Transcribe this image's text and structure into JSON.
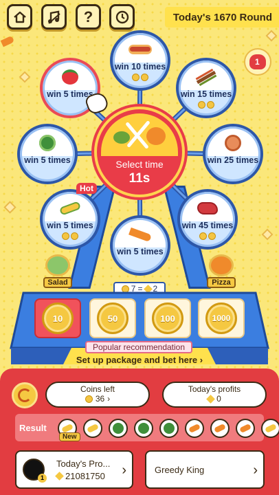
{
  "header": {
    "round_title": "Today's 1670 Round"
  },
  "wheel": {
    "pods": [
      {
        "label": "win 10 times",
        "food": "hotdog-icon",
        "coins": 2
      },
      {
        "label": "win 15 times",
        "food": "kebab-icon",
        "coins": 2
      },
      {
        "label": "win 25 times",
        "food": "ham-icon",
        "coins": 0
      },
      {
        "label": "win 45 times",
        "food": "steak-icon",
        "coins": 2
      },
      {
        "label": "win 5 times",
        "food": "carrot-icon",
        "coins": 0
      },
      {
        "label": "win 5 times",
        "food": "corn-icon",
        "coins": 2
      },
      {
        "label": "win 5 times",
        "food": "cabbage-icon",
        "coins": 0
      },
      {
        "label": "win 5 times",
        "food": "tomato-icon",
        "coins": 0
      }
    ],
    "hot_badge": "Hot",
    "hub_title": "Select time",
    "hub_timer": "11s"
  },
  "side_items": {
    "salad": "Salad",
    "pizza": "Pizza"
  },
  "exchange": {
    "left": "7",
    "right": "2",
    "equals": "="
  },
  "bets": [
    {
      "value": "10"
    },
    {
      "value": "50"
    },
    {
      "value": "100"
    },
    {
      "value": "1000"
    }
  ],
  "popular": "Popular recommendation",
  "package": "Set up package and bet here",
  "coins_left": {
    "label": "Coins left",
    "value": "36"
  },
  "profits": {
    "label": "Today's profits",
    "value": "0"
  },
  "result": {
    "label": "Result",
    "new_badge": "New"
  },
  "player": {
    "name": "Today's Pro...",
    "value": "21081750",
    "badge": "1"
  },
  "ranking": {
    "label": "Greedy King"
  },
  "colors": {
    "accent_red": "#e23d41",
    "wheel_blue": "#2d57a8",
    "gold": "#f5c842"
  }
}
